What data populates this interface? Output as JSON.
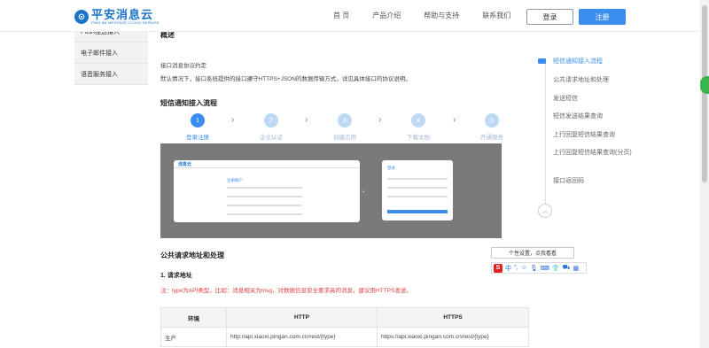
{
  "header": {
    "logo_mark": "⊙",
    "logo_cn": "平安消息云",
    "logo_en": "PING AN MESSAGE CLOUD SERVICE",
    "nav": [
      "首 页",
      "产品介绍",
      "帮助与支持",
      "联系我们"
    ],
    "login": "登录",
    "register": "注册"
  },
  "sidebar": {
    "items": [
      "Push推送接入",
      "电子邮件接入",
      "语音服务接入"
    ]
  },
  "main": {
    "overview_title": "概述",
    "intro1": "接口消息协议约定",
    "intro2": "默认情况下，接口系统提供的接口遵守HTTPS+JSON的数据传输方式，详见具体接口的协议说明。",
    "flow_title": "短信通知接入流程",
    "steps": [
      {
        "num": "1",
        "label": "登录注册"
      },
      {
        "num": "2",
        "label": "企业认证"
      },
      {
        "num": "3",
        "label": "创建应用"
      },
      {
        "num": "4",
        "label": "下载文档"
      },
      {
        "num": "5",
        "label": "开通服务"
      }
    ],
    "mock": {
      "logo": "消息云",
      "form_title": "注册账户",
      "dots": "• ◦ •",
      "phone_title": "登录"
    },
    "public_title": "公共请求地址和处理",
    "req_title": "1. 请求地址",
    "note": "注：type为API类型，比如：消息相关为msg，对数据信息安全要求高的消息，建议用HTTPS发送。",
    "table": {
      "headers": [
        "环境",
        "HTTP",
        "HTTPS"
      ],
      "rows": [
        [
          "生产",
          "http://api.xiaoxi.pingan.com.cn/rest/{type}",
          "https://api.xiaoxi.pingan.com.cn/rest/{type}"
        ]
      ]
    }
  },
  "toc": {
    "items": [
      "短信通知接入流程",
      "公共请求地址和处理",
      "发送短信",
      "短信发送结果查询",
      "上行回复短信结果查询",
      "上行回复短信结果查询(分页)",
      "接口返回码"
    ],
    "up_icon": "︿"
  },
  "ime": {
    "tip": "个性设置，点我看看",
    "s_logo": "S",
    "glyphs": [
      "中",
      "°,",
      "☺",
      "🎙",
      "⌨",
      "👕",
      "⛟",
      "▦"
    ]
  },
  "colors": {
    "accent": "#3b8ded",
    "brand": "#1b73c9",
    "note": "#e04040"
  }
}
